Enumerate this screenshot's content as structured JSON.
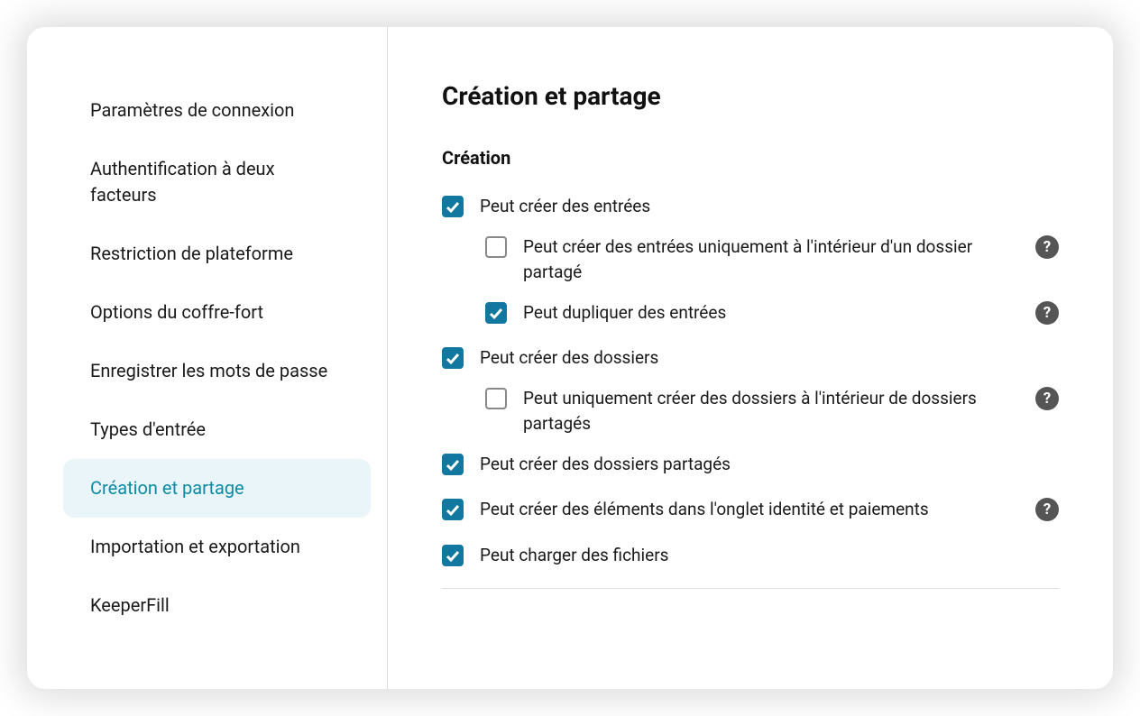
{
  "sidebar": {
    "items": [
      {
        "label": "Paramètres de connexion",
        "active": false
      },
      {
        "label": "Authentification à deux facteurs",
        "active": false
      },
      {
        "label": "Restriction de plateforme",
        "active": false
      },
      {
        "label": "Options du coffre-fort",
        "active": false
      },
      {
        "label": "Enregistrer les mots de passe",
        "active": false
      },
      {
        "label": "Types d'entrée",
        "active": false
      },
      {
        "label": "Création et partage",
        "active": true
      },
      {
        "label": "Importation et exportation",
        "active": false
      },
      {
        "label": "KeeperFill",
        "active": false
      }
    ]
  },
  "content": {
    "title": "Création et partage",
    "section_title": "Création",
    "options": {
      "can_create_entries": {
        "label": "Peut créer des entrées",
        "checked": true
      },
      "entries_shared_only": {
        "label": "Peut créer des entrées uniquement à l'intérieur d'un dossier partagé",
        "checked": false,
        "help": true
      },
      "can_duplicate_entries": {
        "label": "Peut dupliquer des entrées",
        "checked": true,
        "help": true
      },
      "can_create_folders": {
        "label": "Peut créer des dossiers",
        "checked": true
      },
      "folders_shared_only": {
        "label": "Peut uniquement créer des dossiers à l'intérieur de dossiers partagés",
        "checked": false,
        "help": true
      },
      "can_create_shared_folders": {
        "label": "Peut créer des dossiers partagés",
        "checked": true
      },
      "can_create_identity_payments": {
        "label": "Peut créer des éléments dans l'onglet identité et paiements",
        "checked": true,
        "help": true
      },
      "can_upload_files": {
        "label": "Peut charger des fichiers",
        "checked": true
      }
    }
  }
}
